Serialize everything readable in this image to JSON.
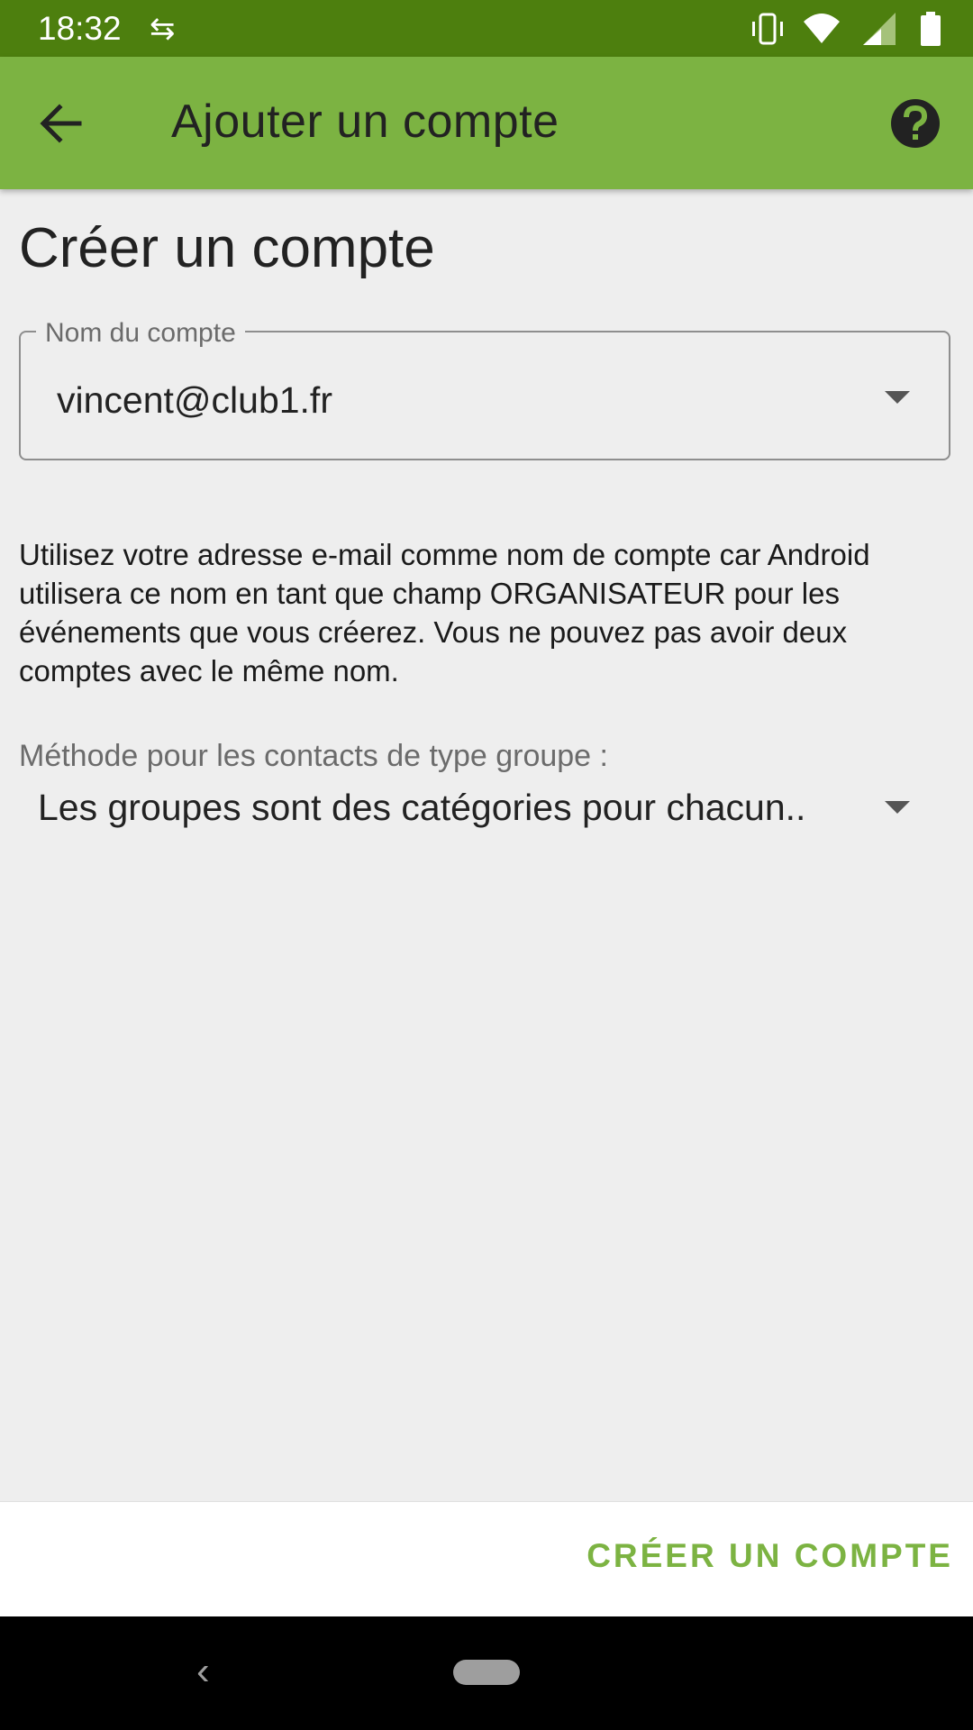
{
  "status_bar": {
    "time": "18:32",
    "sync_glyph": "⇆",
    "icons": [
      "vibrate-icon",
      "wifi-icon",
      "signal-icon",
      "battery-icon"
    ]
  },
  "app_bar": {
    "title": "Ajouter un compte",
    "back_icon": "arrow-back-icon",
    "help_icon": "help-icon",
    "background": "#7cb342",
    "status_background": "#4d7f0e"
  },
  "form": {
    "title": "Créer un compte",
    "account_name": {
      "label": "Nom du compte",
      "value": "vincent@club1.fr"
    },
    "info": "Utilisez votre adresse e-mail comme nom de compte car Android utilisera ce nom en tant que champ ORGANISATEUR pour les événements que vous créerez. Vous ne pouvez pas avoir deux comptes avec le même nom.",
    "group_method": {
      "label": "Méthode pour les contacts de type groupe :",
      "value": "Les groupes sont des catégories pour chacun.."
    }
  },
  "actions": {
    "create_label": "CRÉER UN COMPTE",
    "accent": "#7cb342"
  },
  "nav_bar": {
    "back_glyph": "‹"
  }
}
